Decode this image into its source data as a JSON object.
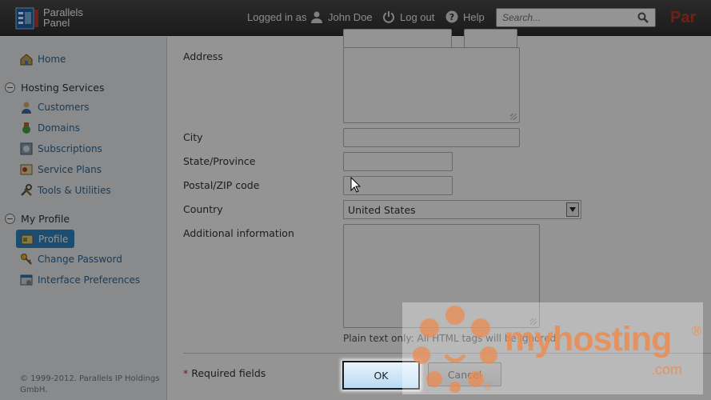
{
  "header": {
    "brand_line1": "Parallels",
    "brand_line2": "Panel",
    "logged_in_as": "Logged in as",
    "user_name": "John Doe",
    "logout": "Log out",
    "help": "Help",
    "search_placeholder": "Search...",
    "brand_right": "Par"
  },
  "sidebar": {
    "home": "Home",
    "hosting_services": "Hosting Services",
    "hosting_items": [
      "Customers",
      "Domains",
      "Subscriptions",
      "Service Plans",
      "Tools & Utilities"
    ],
    "my_profile": "My Profile",
    "profile_items": [
      "Profile",
      "Change Password",
      "Interface Preferences"
    ],
    "copyright": "© 1999-2012. Parallels IP Holdings GmbH."
  },
  "form": {
    "address_label": "Address",
    "city_label": "City",
    "state_label": "State/Province",
    "zip_label": "Postal/ZIP code",
    "country_label": "Country",
    "country_value": "United States",
    "additional_label": "Additional information",
    "hint": "Plain text only: All HTML tags will be ignored.",
    "required_star": "*",
    "required_text": " Required fields",
    "ok": "OK",
    "cancel": "Cancel"
  },
  "watermark": {
    "brand": "myhosting",
    "suffix": ".com",
    "registered": "®"
  },
  "colors": {
    "accent": "#2f86c6",
    "watermark": "#eb8c50",
    "topbar": "#3a3a3a"
  }
}
